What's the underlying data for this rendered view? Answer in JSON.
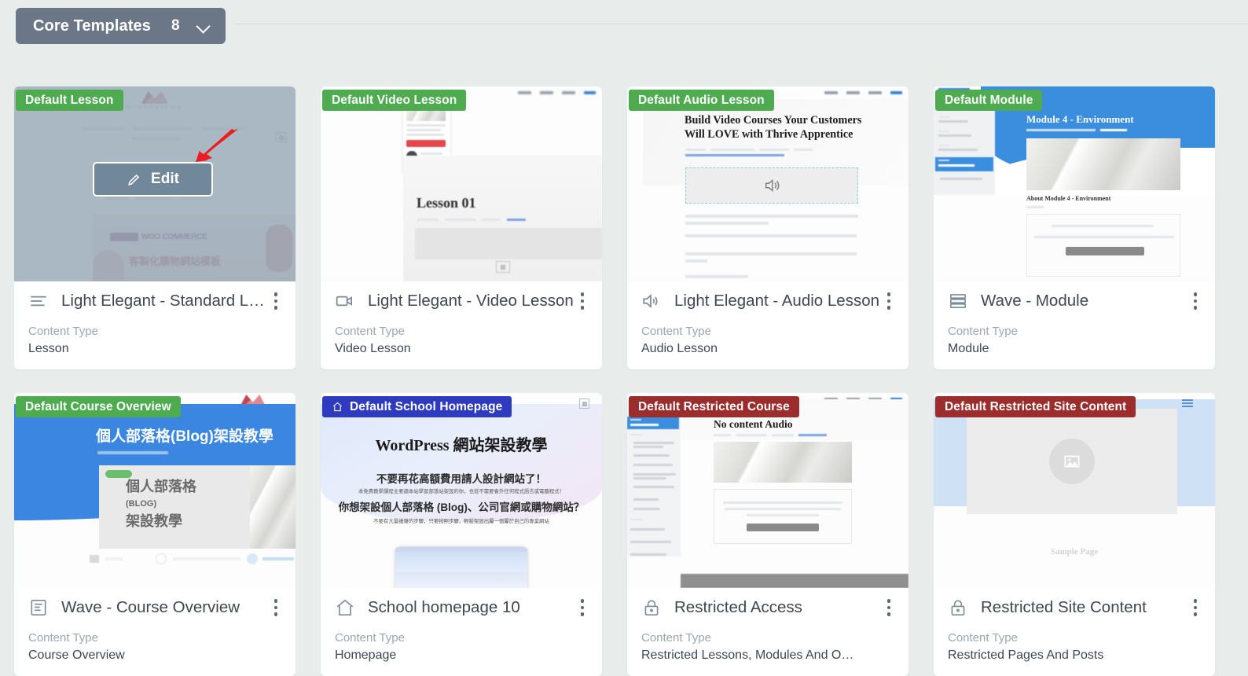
{
  "toolbar": {
    "group_label": "Core Templates",
    "group_count": "8",
    "chevron_icon": "chevron-down-icon"
  },
  "colors": {
    "page_background": "#e8edec",
    "pill": "#6b7786",
    "badge_green": "#4eab4f",
    "badge_blue": "#2f3bbf",
    "badge_red": "#9c2d2d",
    "edit_button": "#70889a",
    "hover_overlay": "#96a8b6",
    "annotation_arrow": "#ed1c24",
    "title_text": "#3e4852",
    "meta_label": "#9aa7b2"
  },
  "hover_card": {
    "edit_label": "Edit",
    "edit_icon": "pencil-icon",
    "annotation": "red-arrow-annotation"
  },
  "meta_label": "Content Type",
  "cards": [
    {
      "badge": "Default Lesson",
      "badge_color": "green",
      "badge_icon": null,
      "title": "Light Elegant - Standard Lesson",
      "icon": "lesson-lines-icon",
      "content_type": "Lesson",
      "preview_watermark": "MYMERRYLIFE",
      "preview_brand": "WOO COMMERCE",
      "preview_caption": "客製化購物網站模板",
      "hovered": true
    },
    {
      "badge": "Default Video Lesson",
      "badge_color": "green",
      "badge_icon": null,
      "title": "Light Elegant - Video Lesson",
      "icon": "video-camera-icon",
      "content_type": "Video Lesson",
      "preview_heading": "Lesson 01",
      "hovered": false
    },
    {
      "badge": "Default Audio Lesson",
      "badge_color": "green",
      "badge_icon": null,
      "title": "Light Elegant - Audio Lesson",
      "icon": "speaker-icon",
      "content_type": "Audio Lesson",
      "preview_heading": "Build Video Courses Your Customers Will LOVE with Thrive Apprentice",
      "preview_player_icon": "speaker-icon",
      "hovered": false
    },
    {
      "badge": "Default Module",
      "badge_color": "green",
      "badge_icon": null,
      "title": "Wave - Module",
      "icon": "module-stack-icon",
      "content_type": "Module",
      "preview_heading": "Module 4 - Environment",
      "preview_subheading": "About Module 4 - Environment",
      "hovered": false
    },
    {
      "badge": "Default Course Overview",
      "badge_color": "green",
      "badge_icon": null,
      "title": "Wave - Course Overview",
      "icon": "document-lines-icon",
      "content_type": "Course Overview",
      "preview_heading": "個人部落格(Blog)架設教學",
      "preview_card_line1": "個人部落格",
      "preview_card_line2": "(BLOG)",
      "preview_card_line3": "架設教學",
      "hovered": false
    },
    {
      "badge": "Default School Homepage",
      "badge_color": "blue",
      "badge_icon": "home-icon",
      "title": "School homepage 10",
      "icon": "home-icon",
      "content_type": "Homepage",
      "preview_heading": "WordPress 網站架設教學",
      "preview_line2": "不要再花高額費用請人設計網站了！",
      "preview_line3": "你想架設個人部落格 (Blog)、公司官網或購物網站？",
      "hovered": false
    },
    {
      "badge": "Default Restricted Course",
      "badge_color": "red",
      "badge_icon": null,
      "title": "Restricted Access",
      "icon": "lock-icon",
      "content_type": "Restricted Lessons, Modules And O…",
      "preview_heading": "No content Audio",
      "hovered": false
    },
    {
      "badge": "Default Restricted Site Content",
      "badge_color": "red",
      "badge_icon": null,
      "title": "Restricted Site Content",
      "icon": "lock-icon",
      "content_type": "Restricted Pages And Posts",
      "preview_caption": "Sample Page",
      "preview_placeholder_icon": "image-placeholder-icon",
      "hovered": false
    }
  ]
}
